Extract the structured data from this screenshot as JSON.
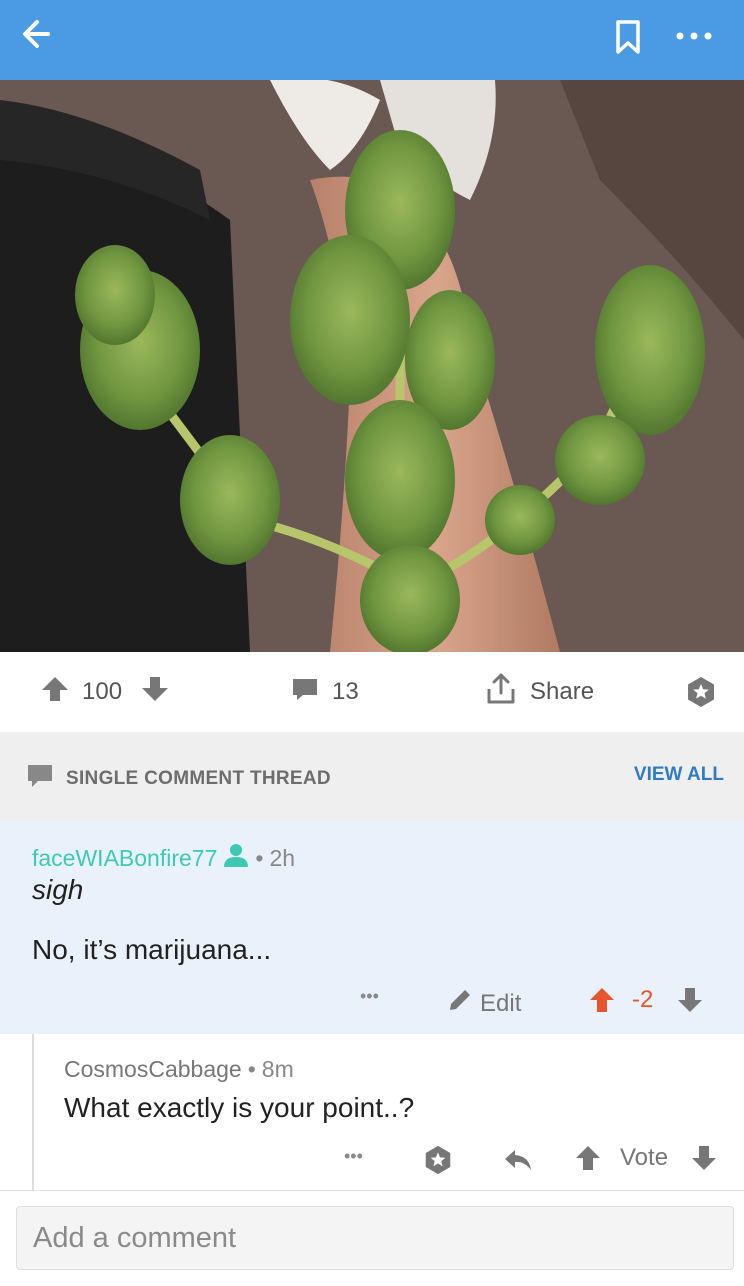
{
  "topbar": {
    "color": "#4a9be3",
    "back_icon": "arrow-left-icon",
    "bookmark_icon": "bookmark-icon",
    "more_icon": "more-horizontal-icon"
  },
  "post": {
    "image_subject": "cannabis branches held on a forearm",
    "upvote_icon": "arrow-up-icon",
    "score": "100",
    "downvote_icon": "arrow-down-icon",
    "comment_icon": "comment-bubble-icon",
    "comments": "13",
    "share_icon": "share-upload-icon",
    "share_label": "Share",
    "award_icon": "award-star-icon"
  },
  "thread": {
    "icon": "comment-bubble-icon",
    "title": "SINGLE COMMENT THREAD",
    "view_all": "VIEW ALL"
  },
  "comments": [
    {
      "author": "faceWIABonfire77",
      "user_icon": "user-icon",
      "time": "2h",
      "body_line1": "sigh",
      "body_line2": "No, it’s marijuana...",
      "more": "•••",
      "edit_label": "Edit",
      "score": "-2",
      "upvote_color": "#e8542b"
    },
    {
      "author": "CosmosCabbage",
      "time": "8m",
      "body": "What exactly is your point..?",
      "more": "•••",
      "vote_label": "Vote"
    }
  ],
  "composer": {
    "placeholder": "Add a comment"
  }
}
